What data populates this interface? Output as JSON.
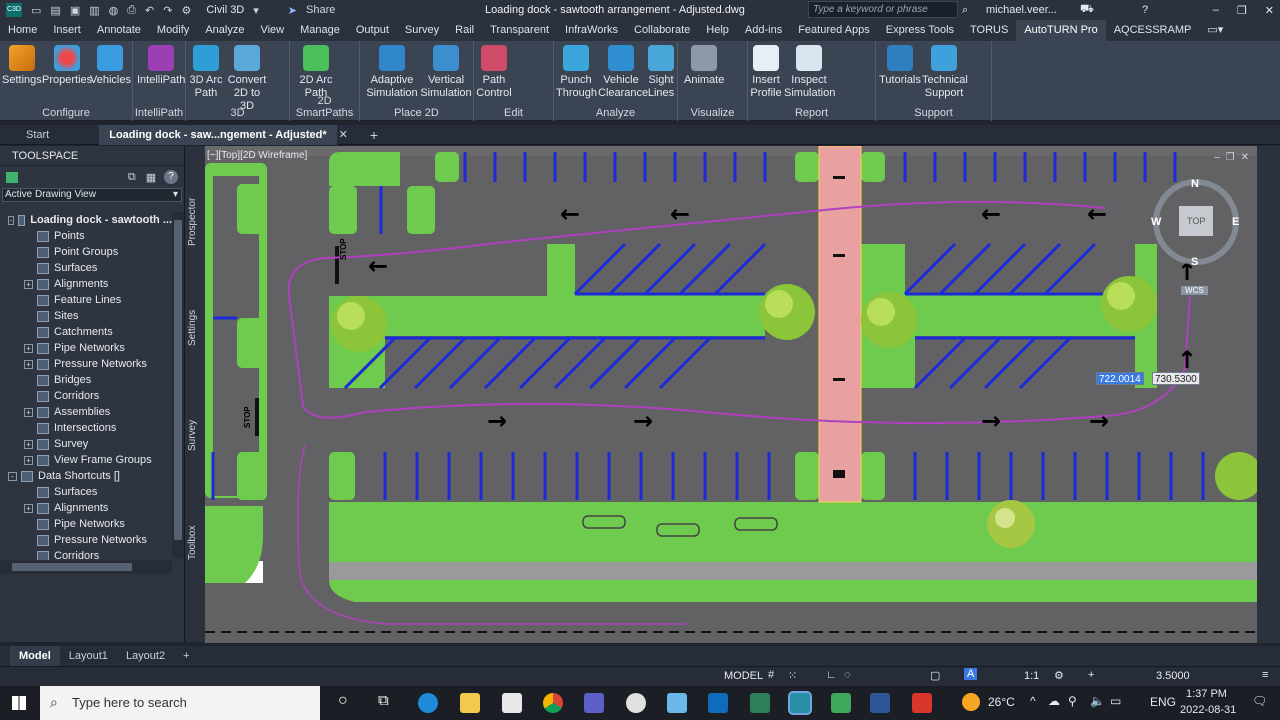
{
  "window": {
    "app_icon_label": "C3D",
    "workspace": "Civil 3D",
    "share": "Share",
    "title": "Loading dock - sawtooth arrangement - Adjusted.dwg",
    "search_placeholder": "Type a keyword or phrase",
    "user": "michael.veer..."
  },
  "ribbon_tabs": [
    "Home",
    "Insert",
    "Annotate",
    "Modify",
    "Analyze",
    "View",
    "Manage",
    "Output",
    "Survey",
    "Rail",
    "Transparent",
    "InfraWorks",
    "Collaborate",
    "Help",
    "Add-ins",
    "Featured Apps",
    "Express Tools",
    "TORUS",
    "AutoTURN Pro",
    "AQCESSRAMP"
  ],
  "active_ribbon_tab": "AutoTURN Pro",
  "panels": {
    "configure": {
      "title": "Configure",
      "tools": [
        "Settings",
        "Properties",
        "Vehicles"
      ]
    },
    "intellipath": {
      "title": "IntelliPath",
      "tools": [
        "IntelliPath"
      ]
    },
    "threed": {
      "title": "3D",
      "tools": [
        "3D Arc Path",
        "Convert 2D to 3D"
      ]
    },
    "smartpaths": {
      "title": "2D SmartPaths",
      "tools": [
        "2D Arc Path"
      ]
    },
    "place2d": {
      "title": "Place 2D",
      "tools": [
        "Adaptive Simulation",
        "Vertical Simulation"
      ]
    },
    "edit": {
      "title": "Edit",
      "tools": [
        "Path Control"
      ]
    },
    "analyze": {
      "title": "Analyze",
      "tools": [
        "Punch Through",
        "Vehicle Clearance",
        "Sight Lines"
      ]
    },
    "visualize": {
      "title": "Visualize",
      "tools": [
        "Animate"
      ]
    },
    "report": {
      "title": "Report",
      "tools": [
        "Insert Profile",
        "Inspect Simulation"
      ]
    },
    "support": {
      "title": "Support",
      "tools": [
        "Tutorials",
        "Technical Support"
      ]
    }
  },
  "doc_tabs": {
    "start": "Start",
    "active": "Loading dock - saw...ngement - Adjusted*"
  },
  "toolspace": {
    "title": "TOOLSPACE",
    "view": "Active Drawing View",
    "tree": [
      {
        "label": "Loading dock - sawtooth ...",
        "level": 0,
        "expander": "-"
      },
      {
        "label": "Points",
        "level": 1,
        "expander": ""
      },
      {
        "label": "Point Groups",
        "level": 1,
        "expander": ""
      },
      {
        "label": "Surfaces",
        "level": 1,
        "expander": ""
      },
      {
        "label": "Alignments",
        "level": 1,
        "expander": "+"
      },
      {
        "label": "Feature Lines",
        "level": 1,
        "expander": ""
      },
      {
        "label": "Sites",
        "level": 1,
        "expander": ""
      },
      {
        "label": "Catchments",
        "level": 1,
        "expander": ""
      },
      {
        "label": "Pipe Networks",
        "level": 1,
        "expander": "+"
      },
      {
        "label": "Pressure Networks",
        "level": 1,
        "expander": "+"
      },
      {
        "label": "Bridges",
        "level": 1,
        "expander": ""
      },
      {
        "label": "Corridors",
        "level": 1,
        "expander": ""
      },
      {
        "label": "Assemblies",
        "level": 1,
        "expander": "+"
      },
      {
        "label": "Intersections",
        "level": 1,
        "expander": ""
      },
      {
        "label": "Survey",
        "level": 1,
        "expander": "+"
      },
      {
        "label": "View Frame Groups",
        "level": 1,
        "expander": "+"
      },
      {
        "label": "Data Shortcuts []",
        "level": 0,
        "expander": "-"
      },
      {
        "label": "Surfaces",
        "level": 1,
        "expander": ""
      },
      {
        "label": "Alignments",
        "level": 1,
        "expander": "+"
      },
      {
        "label": "Pipe Networks",
        "level": 1,
        "expander": ""
      },
      {
        "label": "Pressure Networks",
        "level": 1,
        "expander": ""
      },
      {
        "label": "Corridors",
        "level": 1,
        "expander": ""
      }
    ],
    "side_tabs": [
      "Prospector",
      "Settings",
      "Survey",
      "Toolbox"
    ]
  },
  "viewport": {
    "label": "[−][Top][2D Wireframe]",
    "coord_x": "722.0014",
    "coord_y": "730.5300",
    "compass": {
      "n": "N",
      "s": "S",
      "e": "E",
      "w": "W",
      "top": "TOP",
      "wcs": "WCS"
    },
    "stop_text": "STOP"
  },
  "layout_tabs": [
    "Model",
    "Layout1",
    "Layout2"
  ],
  "status": {
    "model": "MODEL",
    "scale": "1:1",
    "value": "3.5000"
  },
  "taskbar": {
    "search": "Type here to search",
    "temp": "26°C",
    "lang": "ENG",
    "time": "1:37 PM",
    "date": "2022-08-31"
  },
  "colors": {
    "grass": "#6ecb4e",
    "asphalt": "#626264",
    "stall": "#1b2bd8",
    "crosswalk": "#e8a0a0",
    "path": "#b040c0"
  }
}
